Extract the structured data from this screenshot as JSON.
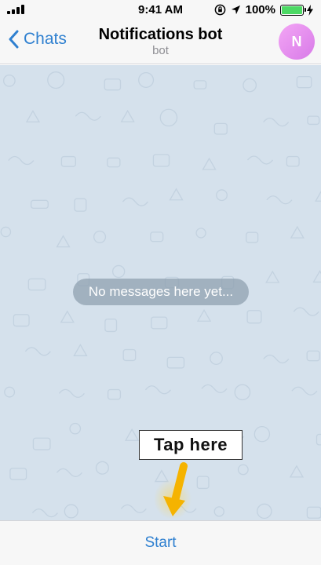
{
  "status_bar": {
    "time": "9:41 AM",
    "battery_percent": "100%",
    "battery_level": 1.0,
    "icons": [
      "signal-icon",
      "rotation-lock-icon",
      "location-arrow-icon",
      "battery-icon",
      "charging-bolt-icon"
    ]
  },
  "nav": {
    "back_label": "Chats",
    "title": "Notifications bot",
    "subtitle": "bot",
    "avatar_initial": "N",
    "avatar_color": "#e08ff0"
  },
  "chat": {
    "empty_text": "No messages here yet...",
    "background_color": "#d5e1ec"
  },
  "hint": {
    "label": "Tap here",
    "arrow_color": "#f5b300"
  },
  "bottom": {
    "start_label": "Start"
  },
  "colors": {
    "accent": "#2f80d0"
  }
}
